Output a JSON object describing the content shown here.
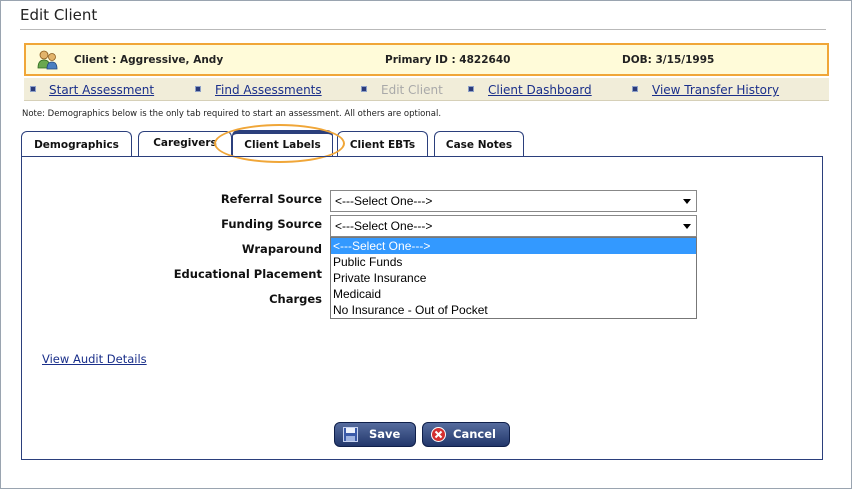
{
  "page": {
    "title": "Edit Client"
  },
  "client": {
    "name": "Client : Aggressive, Andy",
    "primary_id": "Primary ID : 4822640",
    "dob": "DOB: 3/15/1995"
  },
  "nav": {
    "start_assessment": "Start Assessment",
    "find_assessments": "Find Assessments",
    "edit_client": "Edit Client",
    "client_dashboard": "Client Dashboard",
    "view_transfer_history": "View Transfer History"
  },
  "note": "Note: Demographics below is the only tab required to start an assessment. All others are optional.",
  "tabs": {
    "demographics": "Demographics",
    "caregivers": "Caregivers",
    "client_labels": "Client Labels",
    "client_ebts": "Client EBTs",
    "case_notes": "Case Notes",
    "active": "Client Labels"
  },
  "form": {
    "referral_source": {
      "label": "Referral Source",
      "value": "<---Select One--->"
    },
    "funding_source": {
      "label": "Funding Source",
      "value": "<---Select One--->"
    },
    "wraparound": {
      "label": "Wraparound"
    },
    "educational_placement": {
      "label": "Educational Placement"
    },
    "charges": {
      "label": "Charges"
    }
  },
  "funding_dropdown": {
    "options": [
      "<---Select One--->",
      "Public Funds",
      "Private Insurance",
      "Medicaid",
      "No Insurance - Out of Pocket"
    ],
    "highlighted": "<---Select One--->"
  },
  "audit_link": "View Audit Details",
  "buttons": {
    "save": "Save",
    "cancel": "Cancel"
  },
  "colors": {
    "accent": "#2b3f7c",
    "highlight_orange": "#f0a638",
    "client_bar_bg": "#fffbd9",
    "link": "#1a2f8a",
    "dropdown_selected": "#3399ff"
  }
}
